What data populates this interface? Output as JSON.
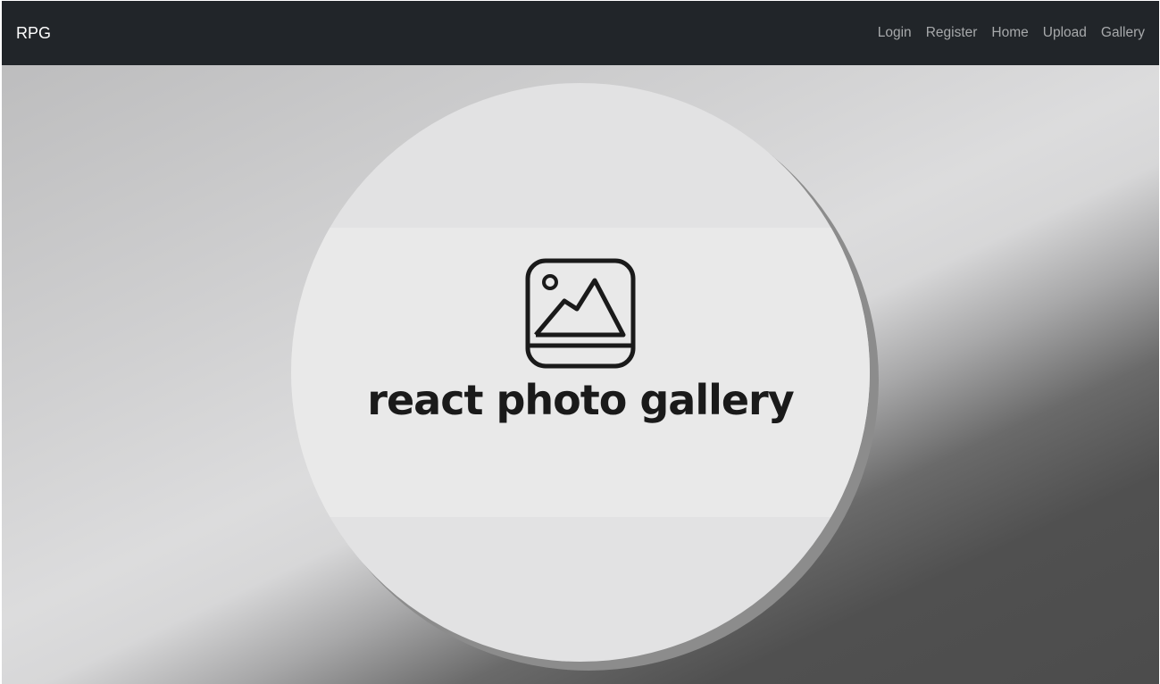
{
  "navbar": {
    "brand": "RPG",
    "links": [
      {
        "label": "Login"
      },
      {
        "label": "Register"
      },
      {
        "label": "Home"
      },
      {
        "label": "Upload"
      },
      {
        "label": "Gallery"
      }
    ]
  },
  "hero": {
    "logo_icon": "image-gallery-icon",
    "logo_text": "react photo gallery"
  },
  "colors": {
    "navbar_bg": "#212529",
    "brand": "#ffffff",
    "nav_link": "#a7a9ab",
    "logo_text": "#1a1a1a"
  }
}
